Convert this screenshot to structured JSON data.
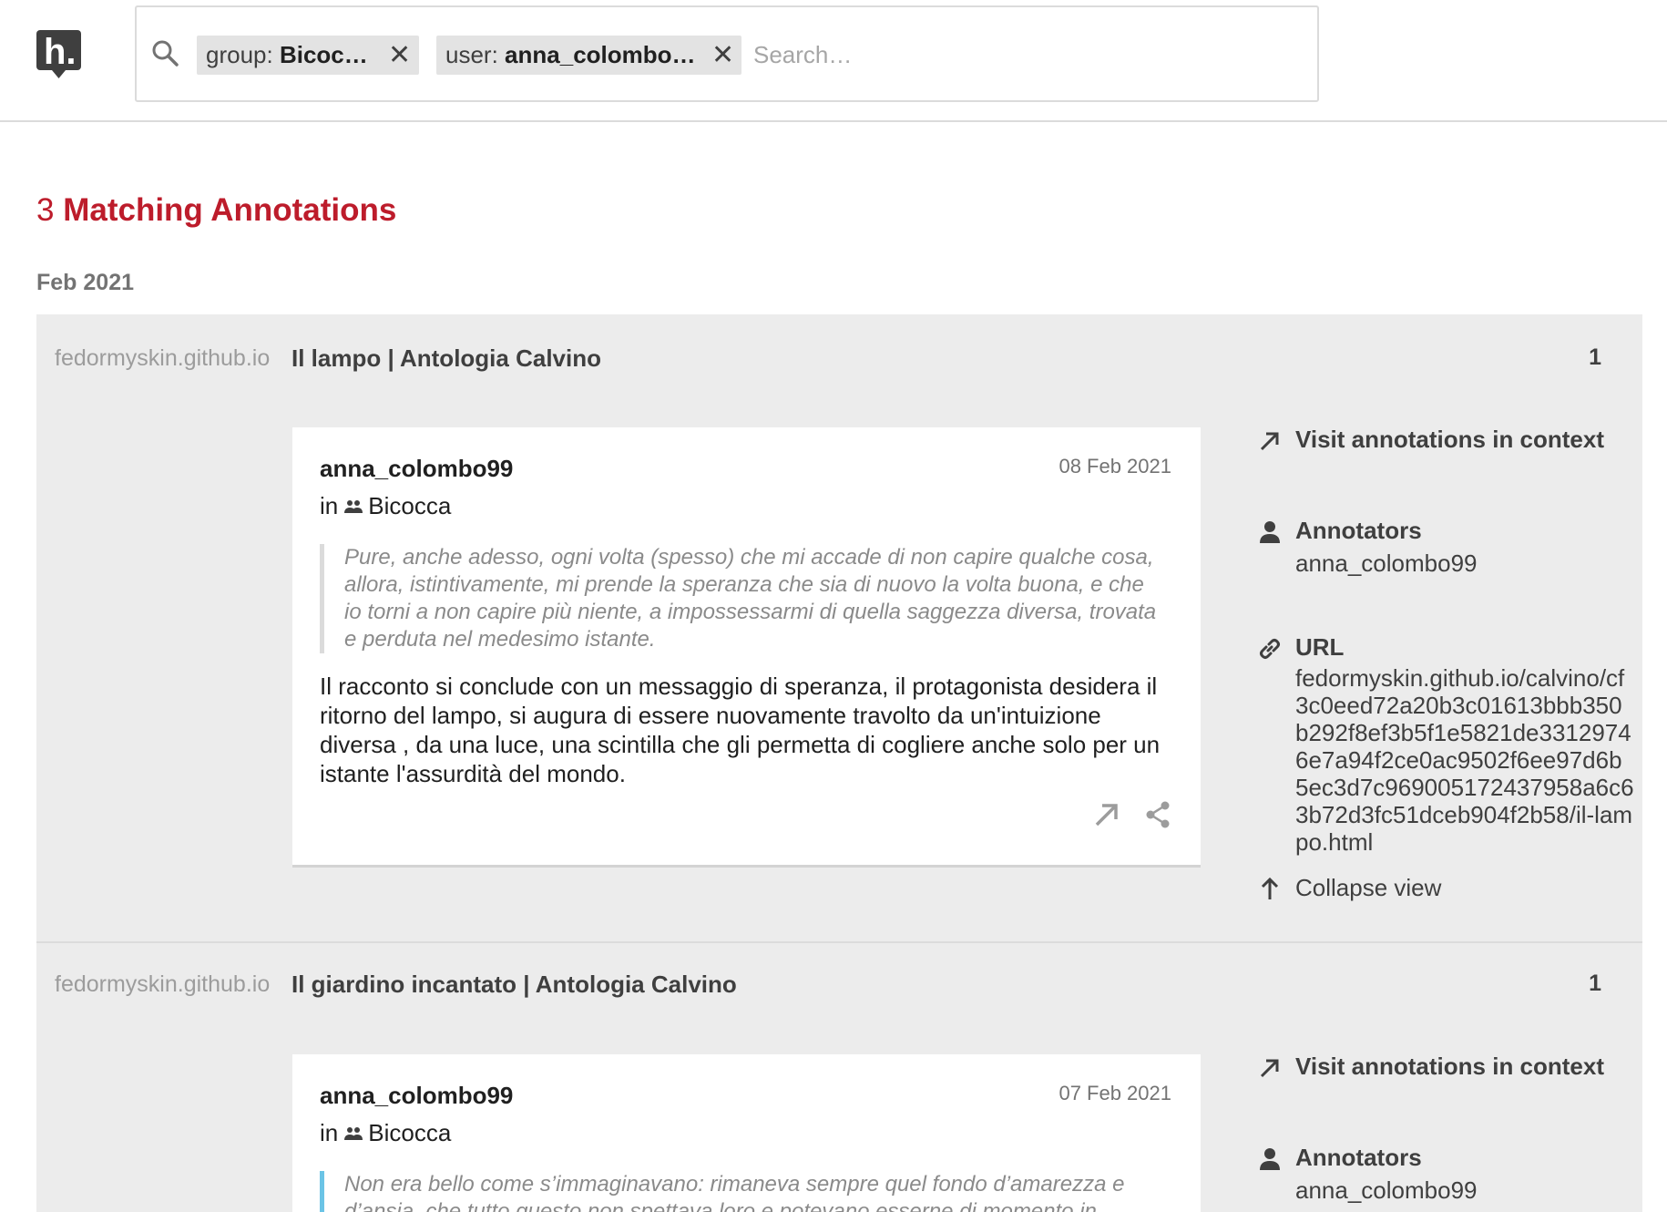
{
  "header": {
    "logo_alt": "h.",
    "chips": [
      {
        "key": "group:",
        "value": "Bicoc…"
      },
      {
        "key": "user:",
        "value": "anna_colombo…"
      }
    ],
    "search_placeholder": "Search…"
  },
  "results": {
    "count": "3",
    "label": "Matching Annotations",
    "month": "Feb 2021"
  },
  "documents": [
    {
      "domain": "fedormyskin.github.io",
      "title": "Il lampo | Antologia Calvino",
      "count": "1",
      "annotation": {
        "user": "anna_colombo99",
        "date": "08 Feb 2021",
        "group_prefix": "in",
        "group": "Bicocca",
        "quote": "Pure, anche adesso, ogni volta (spesso) che mi accade di non capire qualche cosa, allora, istintivamente, mi prende la speranza che sia di nuovo la volta buona, e che io torni a non capire più niente, a impossessarmi di quella saggezza diversa, trovata e perduta nel medesimo istante.",
        "text": "Il racconto si conclude con un messaggio di speranza, il protagonista desidera il ritorno del lampo, si augura di essere nuovamente travolto da un'intuizione diversa , da una luce, una scintilla che gli permetta di cogliere anche solo per un istante l'assurdità del mondo."
      },
      "sidebar": {
        "visit_label": "Visit annotations in context",
        "annotators_label": "Annotators",
        "annotators_value": "anna_colombo99",
        "url_label": "URL",
        "url_value": "fedormyskin.github.io/calvino/cf3c0eed72a20b3c01613bbb350b292f8ef3b5f1e5821de33129746e7a94f2ce0ac9502f6ee97d6b5ec3d7c969005172437958a6c63b72d3fc51dceb904f2b58/il-lampo.html",
        "collapse_label": "Collapse view"
      }
    },
    {
      "domain": "fedormyskin.github.io",
      "title": "Il giardino incantato | Antologia Calvino",
      "count": "1",
      "annotation": {
        "user": "anna_colombo99",
        "date": "07 Feb 2021",
        "group_prefix": "in",
        "group": "Bicocca",
        "quote": "Non era bello come s’immaginavano: rimaneva sempre quel fondo d’amarezza e d’ansia, che tutto questo non spettava loro e potevano esserne di momento in"
      },
      "sidebar": {
        "visit_label": "Visit annotations in context",
        "annotators_label": "Annotators",
        "annotators_value": "anna_colombo99"
      }
    }
  ]
}
